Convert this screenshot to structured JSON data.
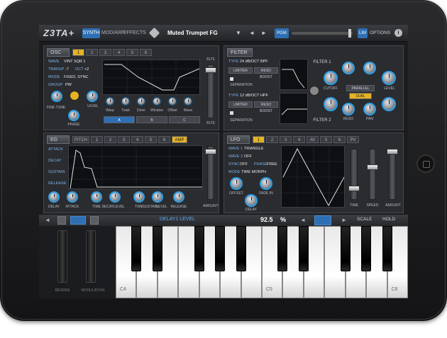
{
  "app": {
    "logo": "Z3TA+",
    "tabs": [
      {
        "label": "SYNTH",
        "active": true
      },
      {
        "label": "MOD/ARP",
        "active": false
      },
      {
        "label": "EFFECTS",
        "active": false
      }
    ],
    "preset_icon": "cube-icon",
    "preset_name": "Muted Trumpet FG",
    "preset_caret": "▼",
    "prev": "◄",
    "next": "►",
    "pgm": "PGM",
    "lim": "LIM",
    "options": "OPTIONS",
    "info": "i"
  },
  "osc": {
    "title": "OSC",
    "tabs": [
      "1",
      "2",
      "3",
      "4",
      "5",
      "6"
    ],
    "active_tab": "1",
    "wave_label": "WAVE",
    "wave_value": "VINT SQR 1",
    "transp_label": "TRANSP",
    "transp_value": "-7",
    "oct_label": "OCT",
    "oct_value": "+2",
    "mode_label": "MODE",
    "mode_value": "FIXED, SYNC",
    "group_label": "GROUP",
    "group_value": "PW",
    "fine_tune": "FINE TUNE",
    "level": "LEVEL",
    "phase": "PHASE",
    "knob_labels": [
      "Warp",
      "Twist",
      "Drive",
      "Window",
      "Offset",
      "Wave"
    ],
    "abc": [
      "A",
      "B",
      "C"
    ],
    "flt1": "FLT1",
    "flt2": "FLT2"
  },
  "filter": {
    "title": "FILTER",
    "f1_type_label": "TYPE",
    "f1_type_value": "24 dB/OCT BPF",
    "f2_type_label": "TYPE",
    "f2_type_value": "12 dB/OCT HPF",
    "limiter": "LIMITER",
    "reso_boost": "RESO BOOST",
    "separation": "SEPARATION",
    "filter1": "FILTER 1",
    "filter2": "FILTER 2",
    "cutoff": "CUTOFF",
    "reso": "RESO",
    "pan": "PAN",
    "level": "LEVEL",
    "parallel": "PARALLEL",
    "dual": "DUAL"
  },
  "eg": {
    "title": "EG",
    "pitch": "PITCH",
    "tabs": [
      "1",
      "2",
      "3",
      "4",
      "5",
      "6"
    ],
    "amp": "AMP",
    "attack": "ATTACK",
    "decay": "DECAY",
    "sustain": "SUSTAIN",
    "release": "RELEASE",
    "knobs": [
      "DELAY",
      "ATTACK",
      "TIME",
      "DECAY",
      "LEVEL",
      "TIME",
      "SUSTAIN",
      "LEVEL",
      "RELEASE"
    ],
    "amount": "AMOUNT"
  },
  "lfo": {
    "title": "LFO",
    "tabs": [
      "1",
      "2",
      "3",
      "4",
      "AV",
      "5",
      "6",
      "PV"
    ],
    "active_tab": "1",
    "wave1_label": "WAVE 1",
    "wave1_value": "TRIANGLE",
    "wave2_label": "WAVE 2",
    "wave2_value": "OFF",
    "sync_label": "SYNC",
    "sync_value": "OFF",
    "phase_label": "PHASE",
    "phase_value": "FREE",
    "mode_label": "MODE",
    "mode_value": "TIME MORPH",
    "offset": "OFFSET",
    "fade_in": "FADE IN",
    "delay": "DELAY",
    "time": "TIME",
    "speed": "SPEED",
    "amount": "AMOUNT"
  },
  "keyboard": {
    "param_name": "DELAY1 LEVEL",
    "param_value": "92.5",
    "param_unit": "%",
    "scale": "SCALE",
    "hold": "HOLD",
    "bender": "BENDER",
    "modulation": "MODULATION",
    "labels": [
      "C4",
      "C5",
      "C6"
    ]
  },
  "colors": {
    "accent_blue": "#2e6fb4",
    "accent_yellow": "#e5b324",
    "label_blue": "#7fb1e6"
  }
}
